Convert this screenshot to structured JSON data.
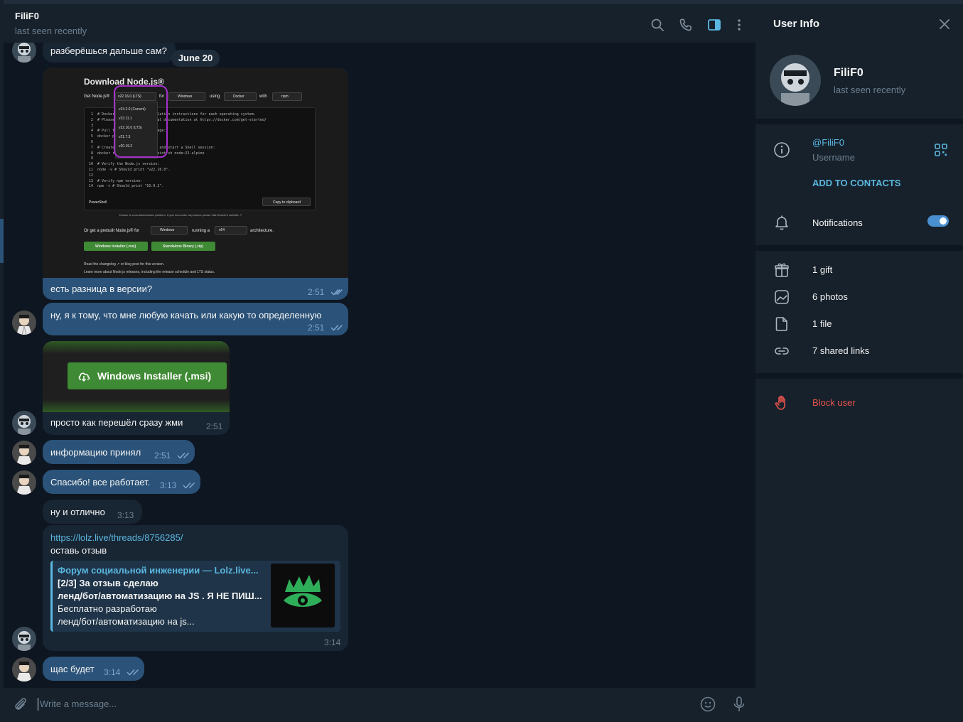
{
  "chat": {
    "name": "FiliF0",
    "status": "last seen recently",
    "date_pill": "June 20",
    "composer_placeholder": "Write a message..."
  },
  "messages": [
    {
      "text": "разберёшься дальше сам?",
      "time": ""
    },
    {
      "text": "есть разница в версии?",
      "time": "2:51"
    },
    {
      "text": "ну, я к тому, что мне любую качать или какую то определенную",
      "time": "2:51"
    },
    {
      "text": "просто как перешёл сразу жми",
      "time": "2:51"
    },
    {
      "text": "информацию принял",
      "time": "2:51"
    },
    {
      "text": "Спасибо! все работает.",
      "time": "3:13"
    },
    {
      "text": "ну и отлично",
      "time": "3:13"
    },
    {
      "text": "оставь отзыв",
      "time": "3:14"
    },
    {
      "text": "щас будет",
      "time": "3:14"
    }
  ],
  "link": {
    "url": "https://lolz.live/threads/8756285/",
    "preview_title": "Форум социальной инженерии — Lolz.live...",
    "preview_line1": "[2/3] За отзыв сделаю",
    "preview_line2": "ленд/бот/автоматизацию на JS . Я НЕ ПИШ...",
    "preview_line3": "Бесплатно разработаю",
    "preview_line4": "ленд/бот/автоматизацию на js..."
  },
  "screenshot": {
    "heading": "Download Node.js®",
    "get_label": "Get Node.js®",
    "version_selected": "v22.16.0 (LTS)",
    "for_label": "for",
    "os": "Windows",
    "using_label": "using",
    "tool": "Docker",
    "with_label": "with",
    "pm": "npm",
    "version_options": [
      "v24.2.0 (Current)",
      "v23.11.1",
      "v22.16.0 (LTS)",
      "v21.7.3",
      "v20.19.2"
    ],
    "code_lines": [
      "# Docker has specific installation instructions for each operating system.",
      "# Please refer to the official documentation at https://docker.com/get-started/",
      "",
      "# Pull the Node.js Docker image:",
      "docker pull node:22-alpine",
      "",
      "# Create a Node.js container and start a Shell session:",
      "docker run -it --rm --entrypoint sh node:22-alpine",
      "",
      "# Verify the Node.js version:",
      "node -v # Should print \"v22.16.0\".",
      "",
      "# Verify npm version:",
      "npm -v # Should print \"10.9.2\"."
    ],
    "shell_label": "PowerShell",
    "copy_label": "Copy to clipboard",
    "docker_note": "Docker is a containerization platform. If you encounter any issues please visit Docker's website ↗",
    "prebuilt_label": "Or get a prebuilt Node.js® for",
    "running_label": "running a",
    "arch": "x64",
    "architecture_label": "architecture.",
    "installer_label": "Windows Installer (.msi)",
    "binary_label": "Standalone Binary (.zip)",
    "read_note": "Read the changelog ↗ or blog post for this version.",
    "learn_note": "Learn more about Node.js releases, including the release schedule and LTS status."
  },
  "msi_button": "Windows Installer (.msi)",
  "user_info": {
    "title": "User Info",
    "name": "FiliF0",
    "status": "last seen recently",
    "username": "@FiliF0",
    "username_label": "Username",
    "add_contacts": "ADD TO CONTACTS",
    "notifications": "Notifications",
    "notifications_on": true,
    "gifts": "1 gift",
    "photos": "6 photos",
    "files": "1 file",
    "links": "7 shared links",
    "block": "Block user"
  },
  "colors": {
    "accent": "#5ab7e0",
    "outgoing": "#2b5278",
    "incoming": "#182533",
    "danger": "#e5534b",
    "node_green": "#3f8a34"
  }
}
